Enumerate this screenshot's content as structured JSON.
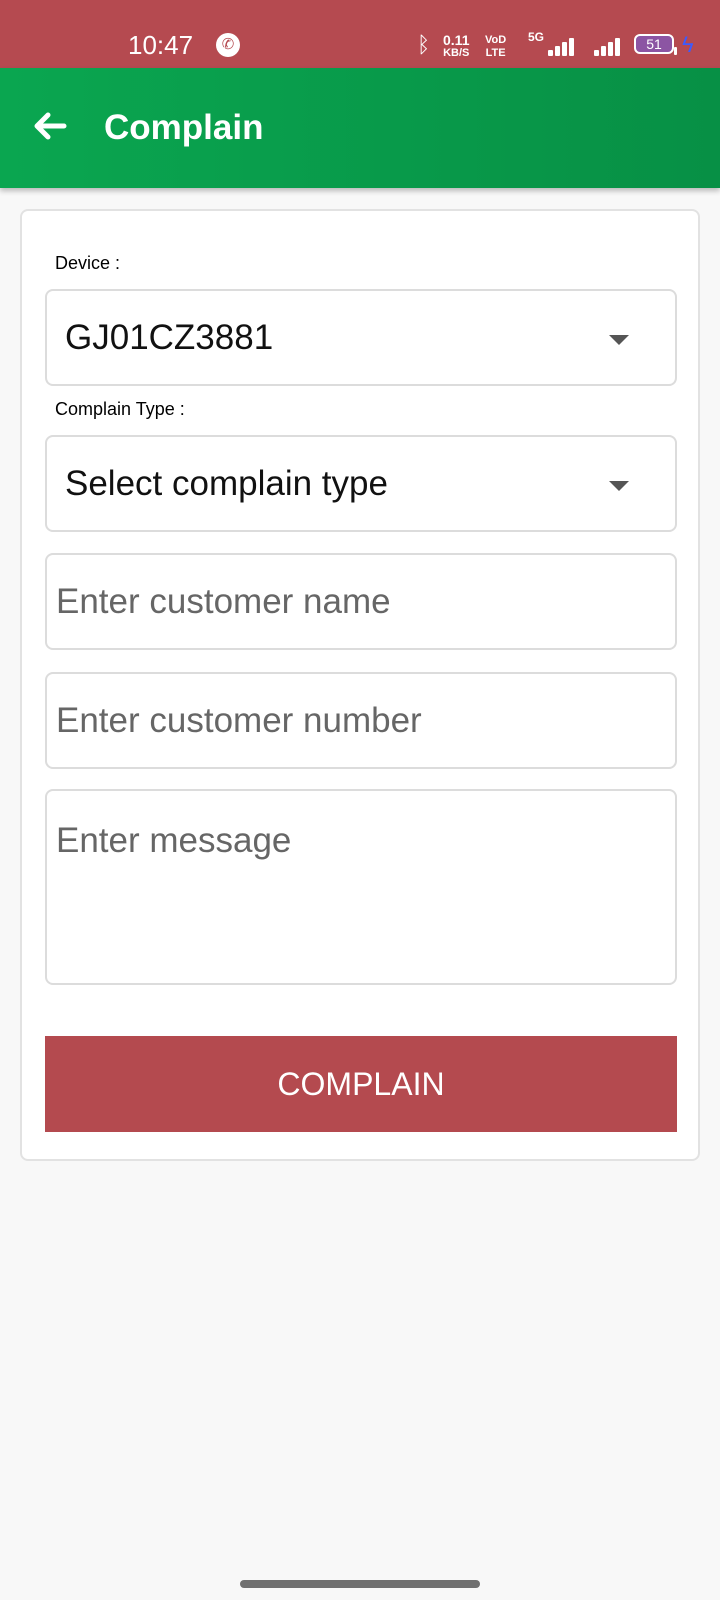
{
  "status_bar": {
    "time": "10:47",
    "net_speed": "0.11",
    "net_speed_unit": "KB/S",
    "volte_top": "VoD",
    "volte_bottom": "LTE",
    "network_type": "5G",
    "battery": "51",
    "icons": [
      "call-icon",
      "bluetooth-icon",
      "signal-icon",
      "battery-icon",
      "charging-icon"
    ]
  },
  "app_bar": {
    "title": "Complain",
    "back_icon": "arrow-left-icon"
  },
  "form": {
    "device_label": "Device :",
    "device_value": "GJ01CZ3881",
    "complain_type_label": "Complain Type :",
    "complain_type_value": "Select complain type",
    "customer_name_placeholder": "Enter customer name",
    "customer_number_placeholder": "Enter customer number",
    "message_placeholder": "Enter message",
    "submit_label": "COMPLAIN"
  },
  "colors": {
    "status_bar": "#b54a50",
    "app_bar": "#0aa650",
    "button": "#b44a4f",
    "background": "#f8f8f8"
  }
}
